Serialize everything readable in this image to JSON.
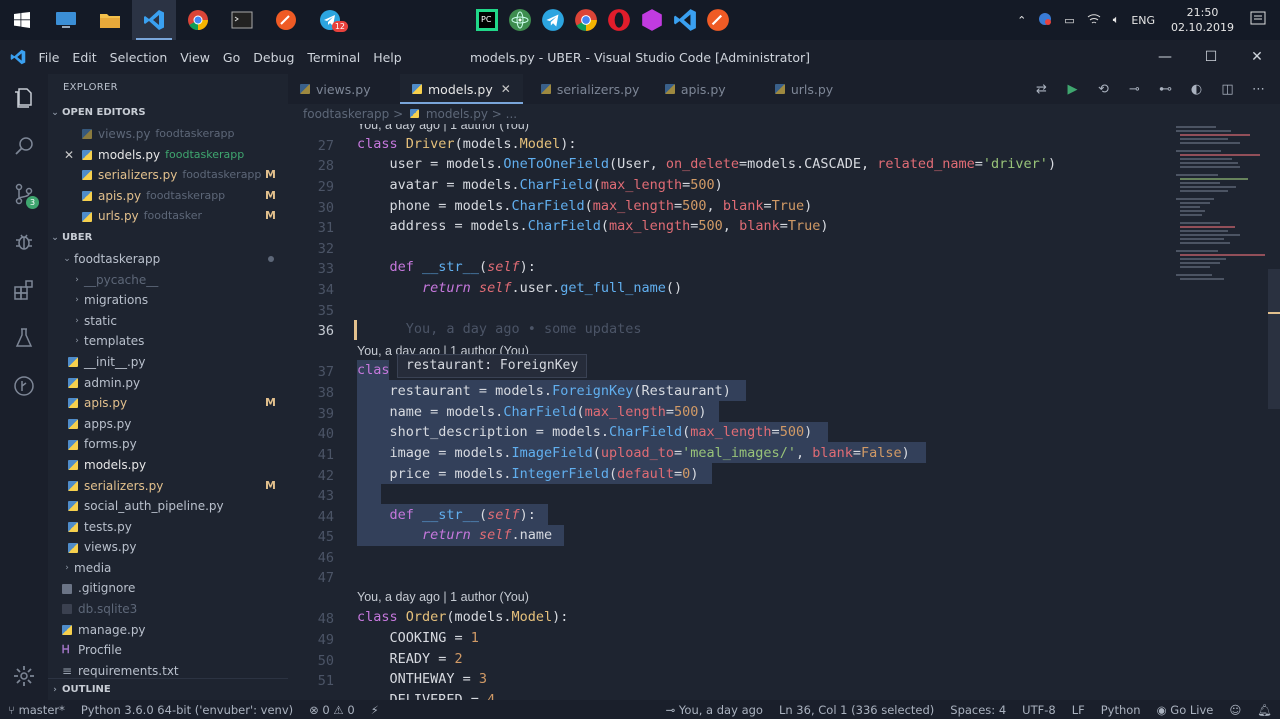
{
  "taskbar": {
    "left_apps": [
      "desktop-app",
      "file-explorer",
      "vscode",
      "chrome",
      "terminal",
      "postman",
      "telegram"
    ],
    "telegram_badge": "12",
    "center_apps": [
      "pycharm",
      "atom",
      "telegram",
      "chrome",
      "opera",
      "affinity",
      "vscode",
      "postman"
    ],
    "tray": {
      "lang": "ENG",
      "time": "21:50",
      "date": "02.10.2019"
    }
  },
  "window": {
    "title": "models.py - UBER - Visual Studio Code [Administrator]",
    "menu": [
      "File",
      "Edit",
      "Selection",
      "View",
      "Go",
      "Debug",
      "Terminal",
      "Help"
    ]
  },
  "activity": {
    "scm_badge": "3"
  },
  "explorer": {
    "title": "EXPLORER",
    "open_editors_label": "OPEN EDITORS",
    "open_editors": [
      {
        "name": "views.py",
        "folder": "foodtaskerapp",
        "modified": "",
        "dim": true
      },
      {
        "name": "models.py",
        "folder": "foodtaskerapp",
        "modified": "",
        "active": true
      },
      {
        "name": "serializers.py",
        "folder": "foodtaskerapp",
        "modified": "M"
      },
      {
        "name": "apis.py",
        "folder": "foodtaskerapp",
        "modified": "M"
      },
      {
        "name": "urls.py",
        "folder": "foodtasker",
        "modified": "M"
      }
    ],
    "workspace_label": "UBER",
    "app_folder": "foodtaskerapp",
    "subfolders": [
      "__pycache__",
      "migrations",
      "static",
      "templates"
    ],
    "files": [
      {
        "name": "__init__.py",
        "modified": ""
      },
      {
        "name": "admin.py",
        "modified": ""
      },
      {
        "name": "apis.py",
        "modified": "M"
      },
      {
        "name": "apps.py",
        "modified": ""
      },
      {
        "name": "forms.py",
        "modified": ""
      },
      {
        "name": "models.py",
        "modified": ""
      },
      {
        "name": "serializers.py",
        "modified": "M"
      },
      {
        "name": "social_auth_pipeline.py",
        "modified": ""
      },
      {
        "name": "tests.py",
        "modified": ""
      },
      {
        "name": "views.py",
        "modified": ""
      }
    ],
    "root_items": [
      "media",
      ".gitignore",
      "db.sqlite3",
      "manage.py",
      "Procfile",
      "requirements.txt"
    ],
    "outline_label": "OUTLINE"
  },
  "tabs": [
    {
      "name": "views.py"
    },
    {
      "name": "models.py",
      "active": true
    },
    {
      "name": "serializers.py"
    },
    {
      "name": "apis.py"
    },
    {
      "name": "urls.py"
    }
  ],
  "breadcrumbs": [
    "foodtaskerapp",
    ">",
    "models.py",
    "> ..."
  ],
  "editor": {
    "blame_top": "You, a day ago | 1 author (You)",
    "blame_mid": "You, a day ago | 1 author (You)",
    "blame_bottom": "You, a day ago | 1 author (You)",
    "inline_blame": "You, a day ago • some updates",
    "hover": "restaurant: ForeignKey",
    "line_numbers": [
      "27",
      "28",
      "29",
      "30",
      "31",
      "32",
      "33",
      "34",
      "35",
      "36",
      "37",
      "38",
      "39",
      "40",
      "41",
      "42",
      "43",
      "44",
      "45",
      "46",
      "47",
      "48",
      "49",
      "50",
      "51"
    ]
  },
  "status": {
    "branch": "master*",
    "python": "Python 3.6.0 64-bit ('envuber': venv)",
    "errors": "0",
    "warnings": "0",
    "blame": "You, a day ago",
    "position": "Ln 36, Col 1 (336 selected)",
    "spaces": "Spaces: 4",
    "encoding": "UTF-8",
    "eol": "LF",
    "language": "Python",
    "golive": "Go Live"
  }
}
